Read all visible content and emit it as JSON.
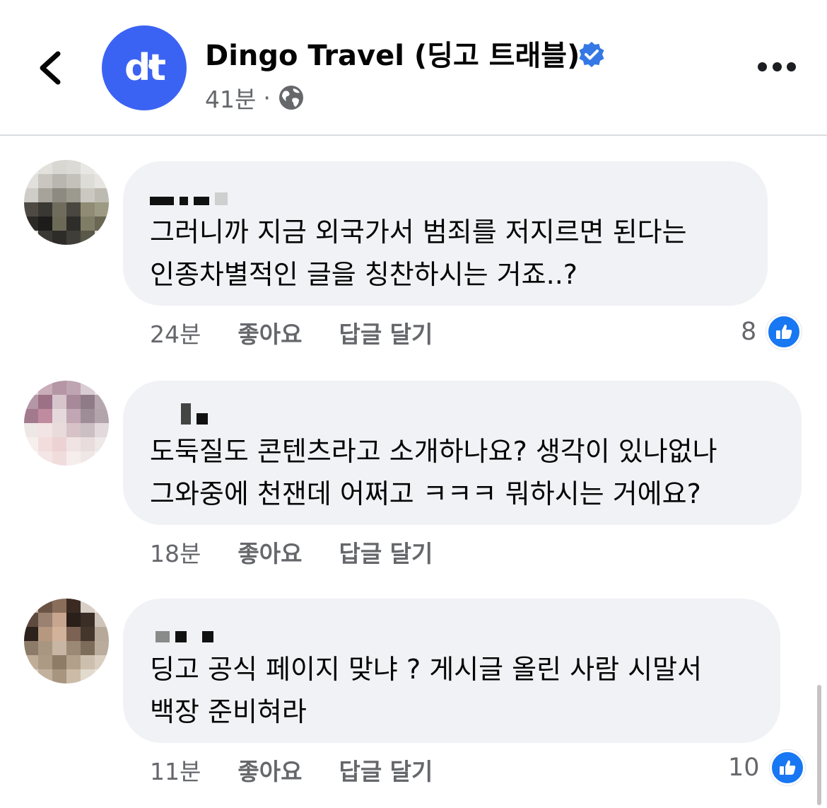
{
  "header": {
    "page_name": "Dingo Travel (딩고 트래블)",
    "logo_text": "dt",
    "time": "41분",
    "separator": "·",
    "brand_color": "#3b63f3",
    "verified_color": "#3578e5"
  },
  "comments": [
    {
      "text": "그러니까 지금 외국가서 범죄를 저지르면 된다는\n인종차별적인 글을 칭찬하시는 거죠..?",
      "time": "24분",
      "like_label": "좋아요",
      "reply_label": "답글 달기",
      "reaction_count": "8"
    },
    {
      "text": "도둑질도 콘텐츠라고 소개하나요? 생각이 있나없나\n그와중에 천잰데 어쩌고 ㅋㅋㅋ 뭐하시는 거에요?",
      "time": "18분",
      "like_label": "좋아요",
      "reply_label": "답글 달기",
      "reaction_count": ""
    },
    {
      "text": "딩고 공식 페이지 맞냐 ? 게시글 올린 사람 시말서\n백장 준비혀라",
      "time": "11분",
      "like_label": "좋아요",
      "reply_label": "답글 달기",
      "reaction_count": "10"
    }
  ],
  "icons": {
    "back": "chevron-left-icon",
    "audience": "globe-icon",
    "more": "more-dots-icon",
    "verified": "verified-badge-icon",
    "reaction": "like-thumb-icon"
  }
}
